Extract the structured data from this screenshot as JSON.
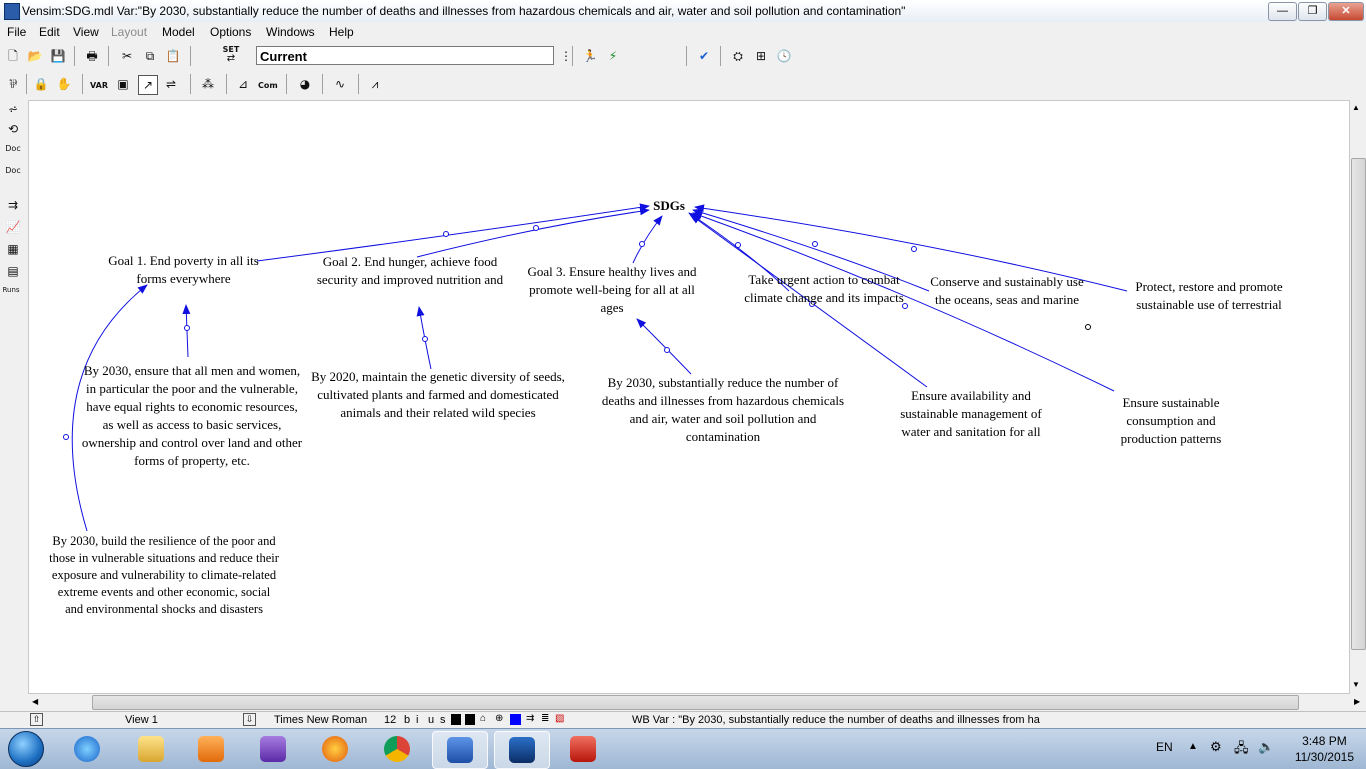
{
  "window": {
    "title": "Vensim:SDG.mdl Var:\"By 2030, substantially reduce the number of deaths and illnesses from hazardous chemicals and air, water and soil pollution and contamination\"",
    "minimize": "—",
    "restore": "❐",
    "close": "✕"
  },
  "menu": [
    "File",
    "Edit",
    "View",
    "Layout",
    "Model",
    "Options",
    "Windows",
    "Help"
  ],
  "toolbar": {
    "set_label": "SET",
    "current_field": "Current",
    "sketch_labels": [
      "VAR",
      "Com"
    ]
  },
  "left_tools": [
    "Doc",
    "Doc",
    "Runs"
  ],
  "diagram": {
    "sdgs": "SDGs",
    "goal1": "Goal 1. End poverty in all its forms everywhere",
    "goal2": "Goal 2. End hunger, achieve food security and improved nutrition and",
    "goal3": "Goal 3. Ensure healthy lives and promote well-being for all at all ages",
    "climate": "Take urgent action to combat climate change and its impacts",
    "oceans": "Conserve and sustainably use the oceans, seas and marine",
    "terrestrial": "Protect, restore and promote sustainable use of terrestrial",
    "water": "Ensure availability and sustainable management of water and sanitation for all",
    "consumption": "Ensure sustainable consumption and production patterns",
    "target_rights": "By 2030, ensure that all men and women, in particular the poor and the vulnerable, have equal rights to economic resources, as well as access to basic services, ownership and control over land and other forms of property, etc.",
    "target_resilience": "By 2030, build the resilience of the poor and those in vulnerable situations and reduce their exposure and vulnerability to climate-related extreme events and other economic, social and environmental shocks and disasters",
    "target_genetic": "By 2020, maintain the genetic diversity of seeds, cultivated plants and farmed and domesticated animals and their related wild species",
    "target_chemicals": "By 2030, substantially reduce the number of deaths and illnesses from hazardous chemicals and air, water and soil pollution and contamination"
  },
  "statusbar": {
    "view": "View 1",
    "font": "Times New Roman",
    "font_size": "12",
    "style_buttons": [
      "b",
      "i",
      "u",
      "s"
    ],
    "var_info": "WB Var : \"By 2030, substantially reduce the number of deaths and illnesses from ha"
  },
  "taskbar": {
    "language": "EN",
    "time": "3:48 PM",
    "date": "11/30/2015"
  }
}
